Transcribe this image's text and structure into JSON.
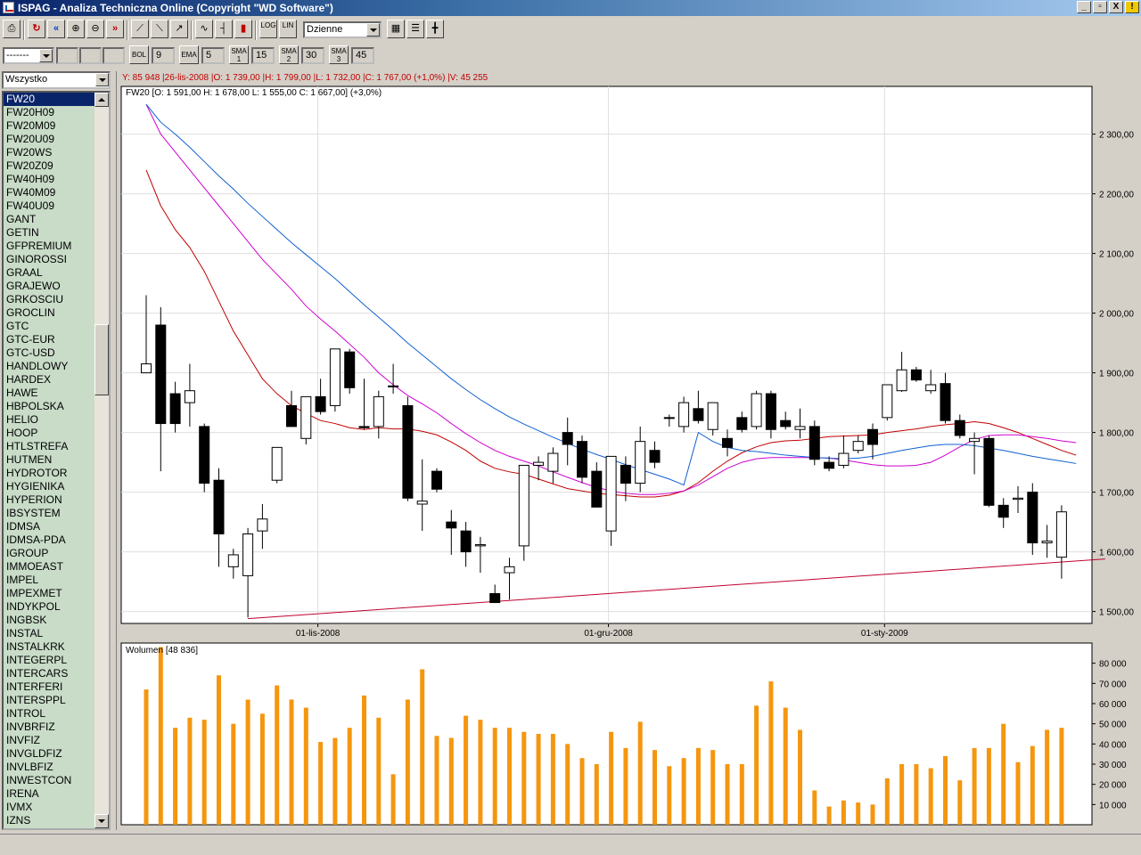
{
  "window": {
    "title": "ISPAG - Analiza Techniczna Online (Copyright \"WD Software\")",
    "buttons": [
      "_",
      "▫",
      "X",
      "!"
    ]
  },
  "toolbar1": {
    "interval_value": "Dzienne",
    "log_label": "LOG",
    "lin_label": "LIN"
  },
  "toolbar2": {
    "select_value": "-------",
    "indicators": [
      {
        "label": "BOL",
        "value": "9"
      },
      {
        "label": "EMA",
        "value": "5"
      },
      {
        "label": "SMA 1",
        "value": "15"
      },
      {
        "label": "SMA 2",
        "value": "30"
      },
      {
        "label": "SMA 3",
        "value": "45"
      }
    ]
  },
  "sidebar": {
    "filter_value": "Wszystko",
    "selected": "FW20",
    "items": [
      "FW20",
      "FW20H09",
      "FW20M09",
      "FW20U09",
      "FW20WS",
      "FW20Z09",
      "FW40H09",
      "FW40M09",
      "FW40U09",
      "GANT",
      "GETIN",
      "GFPREMIUM",
      "GINOROSSI",
      "GRAAL",
      "GRAJEWO",
      "GRKOSCIU",
      "GROCLIN",
      "GTC",
      "GTC-EUR",
      "GTC-USD",
      "HANDLOWY",
      "HARDEX",
      "HAWE",
      "HBPOLSKA",
      "HELIO",
      "HOOP",
      "HTLSTREFA",
      "HUTMEN",
      "HYDROTOR",
      "HYGIENIKA",
      "HYPERION",
      "IBSYSTEM",
      "IDMSA",
      "IDMSA-PDA",
      "IGROUP",
      "IMMOEAST",
      "IMPEL",
      "IMPEXMET",
      "INDYKPOL",
      "INGBSK",
      "INSTAL",
      "INSTALKRK",
      "INTEGERPL",
      "INTERCARS",
      "INTERFERI",
      "INTERSPPL",
      "INTROL",
      "INVBRFIZ",
      "INVFIZ",
      "INVGLDFIZ",
      "INVLBFIZ",
      "INWESTCON",
      "IRENA",
      "IVMX",
      "IZNS"
    ]
  },
  "infobar": "Y: 85 948 |26-lis-2008 |O: 1 739,00 |H: 1 799,00 |L: 1 732,00 |C: 1 767,00 (+1,0%) |V: 45 255",
  "price_panel_label": "FW20 [O: 1 591,00  H: 1 678,00  L: 1 555,00  C: 1 667,00] (+3,0%)",
  "volume_panel_label": "Wolumen [48 836]",
  "colors": {
    "up_candle": "#ffffff",
    "down_candle": "#000000",
    "sma_red": "#c00000",
    "sma_magenta": "#d000d0",
    "sma_blue": "#1060d0",
    "trendline": "#c00030",
    "volume_bar": "#f5960f"
  },
  "chart_data": [
    {
      "type": "candlestick",
      "title": "FW20",
      "x_tick_labels": [
        "01-lis-2008",
        "01-gru-2008",
        "01-sty-2009"
      ],
      "ylim": [
        1480,
        2380
      ],
      "y_tick_labels": [
        "1 500,00",
        "1 600,00",
        "1 700,00",
        "1 800,00",
        "1 900,00",
        "2 000,00",
        "2 100,00",
        "2 200,00",
        "2 300,00"
      ],
      "y_ticks": [
        1500,
        1600,
        1700,
        1800,
        1900,
        2000,
        2100,
        2200,
        2300
      ],
      "x_tick_index": [
        12,
        32,
        51
      ],
      "candles": [
        {
          "o": 1900,
          "h": 2030,
          "l": 1905,
          "c": 1915
        },
        {
          "o": 1980,
          "h": 2010,
          "l": 1735,
          "c": 1815
        },
        {
          "o": 1865,
          "h": 1885,
          "l": 1800,
          "c": 1815
        },
        {
          "o": 1850,
          "h": 1915,
          "l": 1810,
          "c": 1870
        },
        {
          "o": 1810,
          "h": 1815,
          "l": 1700,
          "c": 1715
        },
        {
          "o": 1720,
          "h": 1740,
          "l": 1575,
          "c": 1630
        },
        {
          "o": 1575,
          "h": 1605,
          "l": 1555,
          "c": 1595
        },
        {
          "o": 1560,
          "h": 1640,
          "l": 1490,
          "c": 1630
        },
        {
          "o": 1635,
          "h": 1680,
          "l": 1605,
          "c": 1655
        },
        {
          "o": 1720,
          "h": 1775,
          "l": 1715,
          "c": 1775
        },
        {
          "o": 1845,
          "h": 1870,
          "l": 1810,
          "c": 1810
        },
        {
          "o": 1790,
          "h": 1860,
          "l": 1780,
          "c": 1860
        },
        {
          "o": 1860,
          "h": 1890,
          "l": 1830,
          "c": 1835
        },
        {
          "o": 1845,
          "h": 1940,
          "l": 1835,
          "c": 1940
        },
        {
          "o": 1935,
          "h": 1940,
          "l": 1865,
          "c": 1875
        },
        {
          "o": 1810,
          "h": 1890,
          "l": 1805,
          "c": 1808
        },
        {
          "o": 1810,
          "h": 1870,
          "l": 1790,
          "c": 1860
        },
        {
          "o": 1878,
          "h": 1915,
          "l": 1865,
          "c": 1878
        },
        {
          "o": 1845,
          "h": 1860,
          "l": 1685,
          "c": 1690
        },
        {
          "o": 1680,
          "h": 1755,
          "l": 1635,
          "c": 1685
        },
        {
          "o": 1735,
          "h": 1740,
          "l": 1700,
          "c": 1705
        },
        {
          "o": 1650,
          "h": 1670,
          "l": 1595,
          "c": 1640
        },
        {
          "o": 1635,
          "h": 1650,
          "l": 1575,
          "c": 1600
        },
        {
          "o": 1610,
          "h": 1625,
          "l": 1565,
          "c": 1612
        },
        {
          "o": 1530,
          "h": 1545,
          "l": 1515,
          "c": 1515
        },
        {
          "o": 1565,
          "h": 1590,
          "l": 1520,
          "c": 1575
        },
        {
          "o": 1610,
          "h": 1745,
          "l": 1585,
          "c": 1745
        },
        {
          "o": 1745,
          "h": 1760,
          "l": 1720,
          "c": 1750
        },
        {
          "o": 1735,
          "h": 1775,
          "l": 1715,
          "c": 1765
        },
        {
          "o": 1800,
          "h": 1825,
          "l": 1745,
          "c": 1780
        },
        {
          "o": 1785,
          "h": 1795,
          "l": 1715,
          "c": 1725
        },
        {
          "o": 1735,
          "h": 1750,
          "l": 1675,
          "c": 1675
        },
        {
          "o": 1635,
          "h": 1760,
          "l": 1610,
          "c": 1760
        },
        {
          "o": 1745,
          "h": 1760,
          "l": 1685,
          "c": 1715
        },
        {
          "o": 1715,
          "h": 1810,
          "l": 1700,
          "c": 1785
        },
        {
          "o": 1770,
          "h": 1785,
          "l": 1740,
          "c": 1750
        },
        {
          "o": 1825,
          "h": 1830,
          "l": 1810,
          "c": 1825
        },
        {
          "o": 1810,
          "h": 1860,
          "l": 1800,
          "c": 1850
        },
        {
          "o": 1840,
          "h": 1870,
          "l": 1815,
          "c": 1820
        },
        {
          "o": 1805,
          "h": 1850,
          "l": 1795,
          "c": 1850
        },
        {
          "o": 1790,
          "h": 1805,
          "l": 1760,
          "c": 1775
        },
        {
          "o": 1825,
          "h": 1835,
          "l": 1800,
          "c": 1805
        },
        {
          "o": 1810,
          "h": 1870,
          "l": 1805,
          "c": 1865
        },
        {
          "o": 1865,
          "h": 1870,
          "l": 1790,
          "c": 1805
        },
        {
          "o": 1820,
          "h": 1835,
          "l": 1805,
          "c": 1810
        },
        {
          "o": 1805,
          "h": 1840,
          "l": 1790,
          "c": 1810
        },
        {
          "o": 1810,
          "h": 1820,
          "l": 1745,
          "c": 1755
        },
        {
          "o": 1750,
          "h": 1760,
          "l": 1735,
          "c": 1740
        },
        {
          "o": 1745,
          "h": 1795,
          "l": 1740,
          "c": 1765
        },
        {
          "o": 1770,
          "h": 1795,
          "l": 1765,
          "c": 1785
        },
        {
          "o": 1805,
          "h": 1815,
          "l": 1755,
          "c": 1780
        },
        {
          "o": 1825,
          "h": 1880,
          "l": 1820,
          "c": 1880
        },
        {
          "o": 1870,
          "h": 1935,
          "l": 1868,
          "c": 1905
        },
        {
          "o": 1905,
          "h": 1910,
          "l": 1885,
          "c": 1888
        },
        {
          "o": 1870,
          "h": 1905,
          "l": 1865,
          "c": 1880
        },
        {
          "o": 1882,
          "h": 1900,
          "l": 1815,
          "c": 1820
        },
        {
          "o": 1820,
          "h": 1830,
          "l": 1790,
          "c": 1795
        },
        {
          "o": 1785,
          "h": 1800,
          "l": 1730,
          "c": 1790
        },
        {
          "o": 1790,
          "h": 1795,
          "l": 1675,
          "c": 1678
        },
        {
          "o": 1678,
          "h": 1690,
          "l": 1640,
          "c": 1658
        },
        {
          "o": 1688,
          "h": 1710,
          "l": 1665,
          "c": 1690
        },
        {
          "o": 1700,
          "h": 1715,
          "l": 1595,
          "c": 1615
        },
        {
          "o": 1615,
          "h": 1645,
          "l": 1590,
          "c": 1618
        },
        {
          "o": 1591,
          "h": 1678,
          "l": 1555,
          "c": 1667
        }
      ],
      "sma_series": [
        {
          "color": "#c00000",
          "values": [
            2240,
            2180,
            2140,
            2110,
            2070,
            2020,
            1970,
            1930,
            1890,
            1865,
            1845,
            1832,
            1820,
            1815,
            1808,
            1805,
            1808,
            1806,
            1806,
            1802,
            1796,
            1784,
            1770,
            1752,
            1740,
            1734,
            1730,
            1722,
            1714,
            1706,
            1702,
            1698,
            1696,
            1694,
            1692,
            1692,
            1695,
            1702,
            1716,
            1735,
            1752,
            1766,
            1776,
            1783,
            1786,
            1787,
            1790,
            1793,
            1794,
            1795,
            1796,
            1800,
            1803,
            1806,
            1810,
            1813,
            1815,
            1818,
            1815,
            1808,
            1800,
            1790,
            1780,
            1770,
            1762
          ]
        },
        {
          "color": "#d000d0",
          "values": [
            2350,
            2300,
            2270,
            2240,
            2210,
            2180,
            2150,
            2120,
            2090,
            2065,
            2040,
            2012,
            1990,
            1970,
            1948,
            1926,
            1900,
            1880,
            1862,
            1848,
            1833,
            1815,
            1798,
            1783,
            1770,
            1760,
            1752,
            1744,
            1734,
            1725,
            1716,
            1708,
            1702,
            1698,
            1696,
            1696,
            1698,
            1702,
            1712,
            1726,
            1740,
            1750,
            1756,
            1758,
            1758,
            1758,
            1758,
            1757,
            1754,
            1750,
            1746,
            1744,
            1744,
            1745,
            1750,
            1762,
            1776,
            1788,
            1795,
            1796,
            1796,
            1793,
            1790,
            1786,
            1783
          ]
        },
        {
          "color": "#1060d0",
          "values": [
            2350,
            2320,
            2300,
            2278,
            2254,
            2230,
            2208,
            2184,
            2162,
            2140,
            2118,
            2098,
            2078,
            2058,
            2036,
            2014,
            1993,
            1972,
            1950,
            1930,
            1910,
            1890,
            1872,
            1855,
            1840,
            1826,
            1814,
            1803,
            1792,
            1782,
            1772,
            1763,
            1755,
            1746,
            1738,
            1730,
            1722,
            1712,
            1800,
            1785,
            1775,
            1770,
            1768,
            1765,
            1762,
            1760,
            1758,
            1757,
            1756,
            1757,
            1760,
            1765,
            1770,
            1774,
            1778,
            1780,
            1780,
            1778,
            1774,
            1770,
            1765,
            1760,
            1756,
            1752,
            1748
          ]
        }
      ],
      "trendline": {
        "x_index": [
          7,
          66
        ],
        "values": [
          1488,
          1588
        ]
      }
    },
    {
      "type": "bar",
      "title": "Wolumen",
      "ylim": [
        0,
        90000
      ],
      "y_tick_labels": [
        "10 000",
        "20 000",
        "30 000",
        "40 000",
        "50 000",
        "60 000",
        "70 000",
        "80 000"
      ],
      "y_ticks": [
        10000,
        20000,
        30000,
        40000,
        50000,
        60000,
        70000,
        80000
      ],
      "values": [
        67000,
        88000,
        48000,
        53000,
        52000,
        74000,
        50000,
        62000,
        55000,
        69000,
        62000,
        58000,
        41000,
        43000,
        48000,
        64000,
        53000,
        25000,
        62000,
        77000,
        44000,
        43000,
        54000,
        52000,
        48000,
        48000,
        46000,
        45000,
        45000,
        40000,
        33000,
        30000,
        46000,
        38000,
        51000,
        37000,
        29000,
        33000,
        38000,
        37000,
        30000,
        30000,
        59000,
        71000,
        58000,
        47000,
        17000,
        9000,
        12000,
        11000,
        10000,
        23000,
        30000,
        30000,
        28000,
        34000,
        22000,
        38000,
        38000,
        50000,
        31000,
        39000,
        47000,
        48000
      ]
    }
  ]
}
